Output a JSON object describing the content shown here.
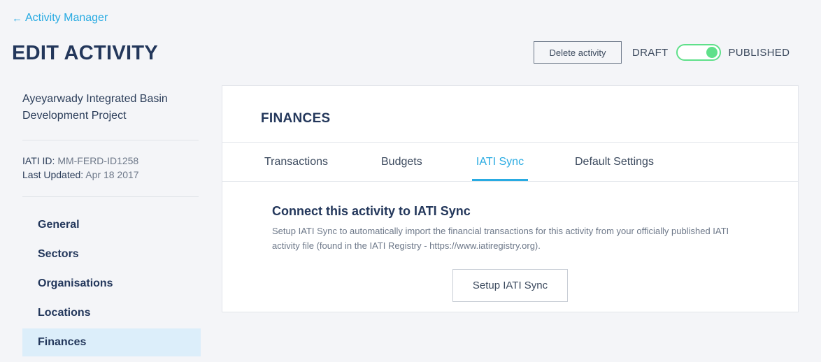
{
  "header": {
    "back_arrow": "←",
    "back_label": "Activity Manager",
    "title": "EDIT ACTIVITY",
    "delete_label": "Delete activity",
    "status_off_label": "DRAFT",
    "status_on_label": "PUBLISHED",
    "toggle_state": "published"
  },
  "sidebar": {
    "project_name": "Ayeyarwady Integrated Basin Development Project",
    "iati_id_label": "IATI ID:",
    "iati_id_value": "MM-FERD-ID1258",
    "updated_label": "Last Updated:",
    "updated_value": "Apr 18 2017",
    "nav": [
      {
        "label": "General"
      },
      {
        "label": "Sectors"
      },
      {
        "label": "Organisations"
      },
      {
        "label": "Locations"
      },
      {
        "label": "Finances",
        "active": true
      }
    ]
  },
  "main": {
    "section_title": "FINANCES",
    "tabs": [
      {
        "label": "Transactions"
      },
      {
        "label": "Budgets"
      },
      {
        "label": "IATI Sync",
        "active": true
      },
      {
        "label": "Default Settings"
      }
    ],
    "sync_heading": "Connect this activity to IATI Sync",
    "sync_description": "Setup IATI Sync to automatically import the financial transactions for this activity from your officially published IATI activity file (found in the IATI Registry - https://www.iatiregistry.org).",
    "setup_button_label": "Setup IATI Sync"
  },
  "colors": {
    "accent": "#29abe2",
    "toggle_on": "#5fe08a",
    "heading": "#23375b",
    "active_nav_bg": "#dceefa"
  }
}
